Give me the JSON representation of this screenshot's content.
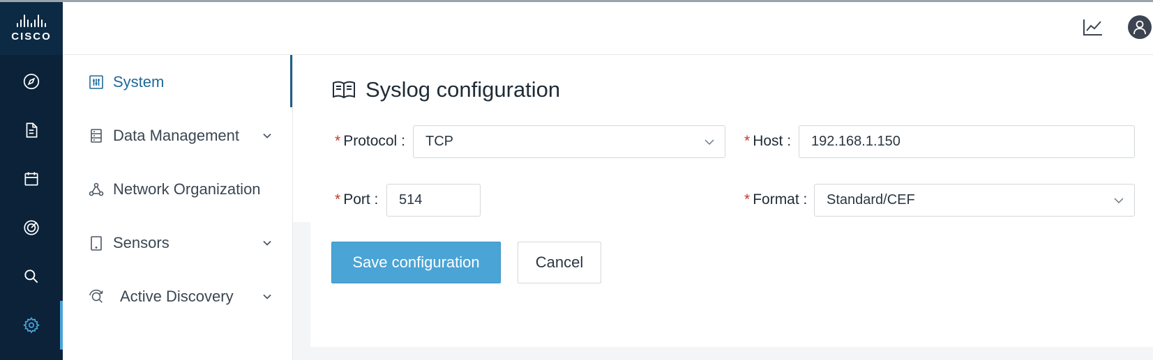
{
  "brand": {
    "logo_text": "CISCO"
  },
  "rail": {
    "items": [
      {
        "icon": "compass-icon"
      },
      {
        "icon": "document-icon"
      },
      {
        "icon": "calendar-icon"
      },
      {
        "icon": "target-icon"
      },
      {
        "icon": "search-icon"
      },
      {
        "icon": "gear-icon",
        "active": true
      }
    ]
  },
  "header": {
    "icons": [
      "chart-icon",
      "user-icon"
    ]
  },
  "sidebar": {
    "items": [
      {
        "label": "System",
        "icon": "sliders-icon",
        "active": true
      },
      {
        "label": "Data Management",
        "icon": "database-icon",
        "expandable": true
      },
      {
        "label": "Network Organization",
        "icon": "network-icon"
      },
      {
        "label": "Sensors",
        "icon": "tablet-icon",
        "expandable": true
      },
      {
        "label": "Active Discovery",
        "icon": "discovery-icon",
        "expandable": true
      }
    ]
  },
  "form": {
    "title": "Syslog configuration",
    "protocol": {
      "label": "Protocol",
      "value": "TCP"
    },
    "host": {
      "label": "Host",
      "value": "192.168.1.150"
    },
    "port": {
      "label": "Port",
      "value": "514"
    },
    "format": {
      "label": "Format",
      "value": "Standard/CEF"
    },
    "required_mark": "*",
    "save_label": "Save configuration",
    "cancel_label": "Cancel"
  },
  "colors": {
    "primary": "#4aa4d6",
    "rail": "#0b2238",
    "active_text": "#1d6a98",
    "required": "#c0392b"
  }
}
